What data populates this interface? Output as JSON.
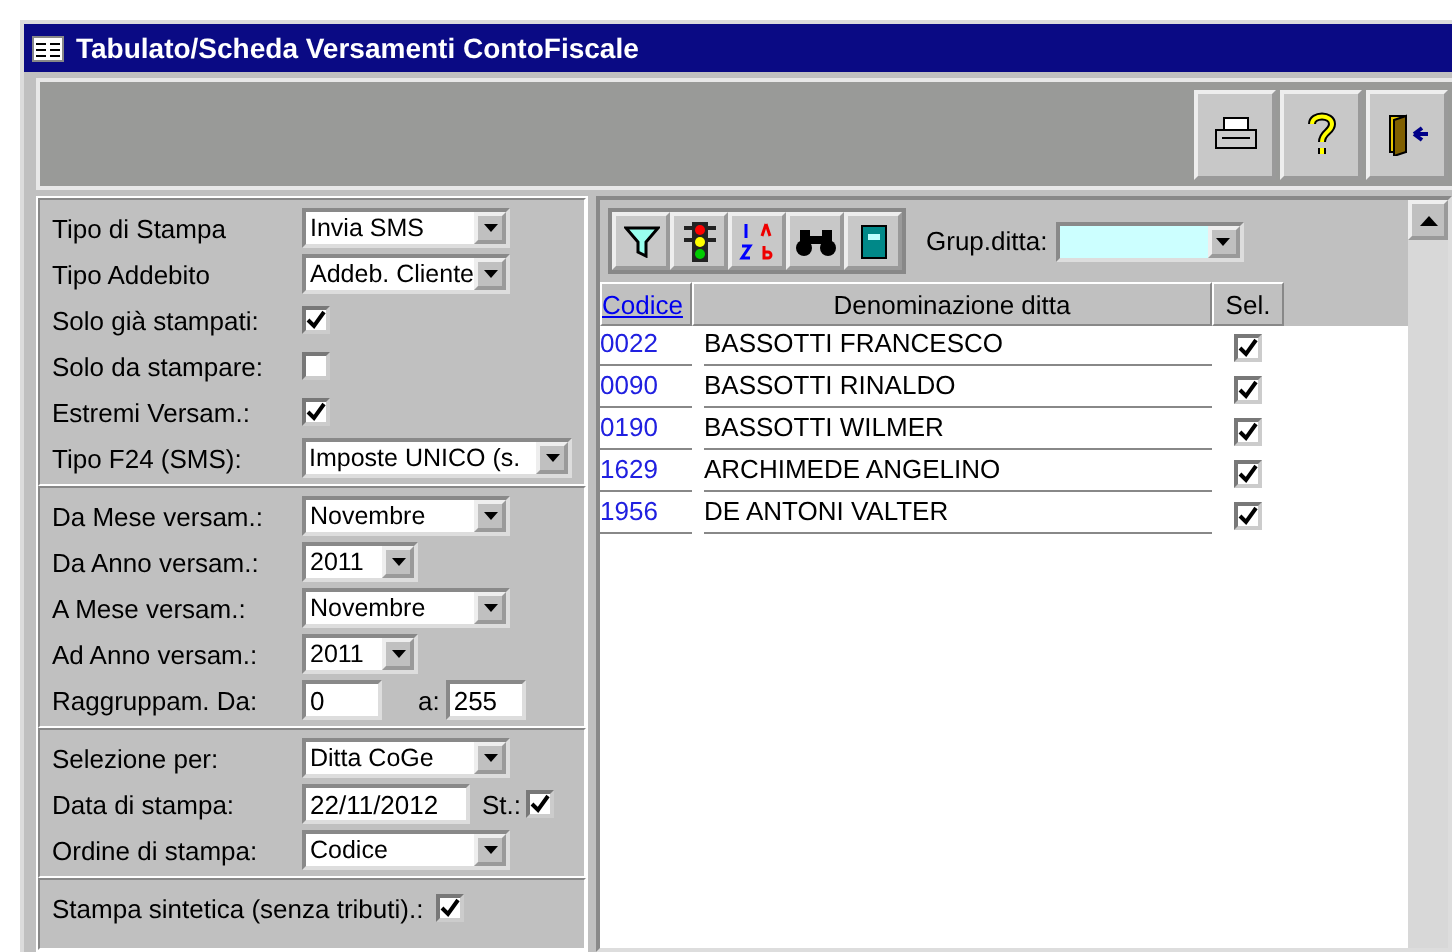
{
  "window": {
    "title": "Tabulato/Scheda Versamenti ContoFiscale"
  },
  "toolbar": {
    "buttons": [
      {
        "kind": "print"
      },
      {
        "kind": "help"
      },
      {
        "kind": "exit"
      }
    ]
  },
  "filters": {
    "sections": [
      {
        "rows": [
          {
            "kind": "select",
            "label": "Tipo di Stampa",
            "value": "Invia SMS"
          },
          {
            "kind": "select",
            "label": "Tipo Addebito",
            "value": "Addeb. Cliente"
          },
          {
            "kind": "checkbox",
            "label": "Solo già stampati:",
            "checked": true
          },
          {
            "kind": "checkbox",
            "label": "Solo da stampare:",
            "checked": false
          },
          {
            "kind": "checkbox",
            "label": "Estremi Versam.:",
            "checked": true
          },
          {
            "kind": "select",
            "label": "Tipo F24 (SMS):",
            "value": "Imposte UNICO (s."
          }
        ]
      },
      {
        "rows": [
          {
            "kind": "select",
            "label": "Da Mese versam.:",
            "value": "Novembre"
          },
          {
            "kind": "select",
            "label": "Da Anno versam.:",
            "value": "2011"
          },
          {
            "kind": "select",
            "label": "A Mese versam.:",
            "value": "Novembre"
          },
          {
            "kind": "select",
            "label": "Ad Anno versam.:",
            "value": "2011"
          },
          {
            "kind": "range",
            "label": "Raggruppam. Da:",
            "value": "0",
            "to_label": "a:",
            "to_value": "255"
          }
        ]
      },
      {
        "rows": [
          {
            "kind": "select",
            "label": "Selezione per:",
            "value": "Ditta CoGe"
          },
          {
            "kind": "date",
            "label": "Data di stampa:",
            "value": "22/11/2012",
            "extra_label": "St.:",
            "checked": true
          },
          {
            "kind": "select",
            "label": "Ordine di stampa:",
            "value": "Codice"
          }
        ]
      }
    ],
    "footer": {
      "kind": "checkbox",
      "label": "Stampa sintetica (senza tributi).:",
      "checked": true
    }
  },
  "list": {
    "tools": [
      {
        "kind": "filter"
      },
      {
        "kind": "traffic"
      },
      {
        "kind": "sort"
      },
      {
        "kind": "binoculars"
      },
      {
        "kind": "book"
      }
    ],
    "group": {
      "label": "Grup.ditta:"
    },
    "columns": [
      "Codice",
      "Denominazione ditta",
      "Sel."
    ],
    "rows": [
      {
        "code": "0022",
        "name": "BASSOTTI FRANCESCO",
        "selected": true
      },
      {
        "code": "0090",
        "name": "BASSOTTI RINALDO",
        "selected": true
      },
      {
        "code": "0190",
        "name": "BASSOTTI WILMER",
        "selected": true
      },
      {
        "code": "1629",
        "name": "ARCHIMEDE ANGELINO",
        "selected": true
      },
      {
        "code": "1956",
        "name": "DE ANTONI VALTER",
        "selected": true
      }
    ]
  }
}
